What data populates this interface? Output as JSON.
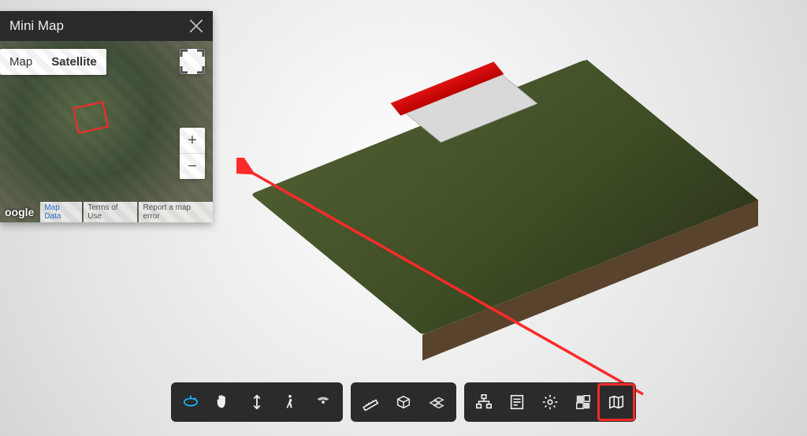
{
  "minimap": {
    "title": "Mini Map",
    "map_tab": "Map",
    "sat_tab": "Satellite",
    "footer_logo": "oogle",
    "footer_links": [
      "Map Data",
      "Terms of Use",
      "Report a map error"
    ],
    "zoom_in": "+",
    "zoom_out": "−"
  },
  "toolbar": {
    "groups": [
      [
        "orbit",
        "pan",
        "updown",
        "walk",
        "fov"
      ],
      [
        "measure",
        "section",
        "explode"
      ],
      [
        "tree",
        "props",
        "settings",
        "fullscreen",
        "map"
      ]
    ],
    "active": "orbit",
    "highlight": "map"
  }
}
